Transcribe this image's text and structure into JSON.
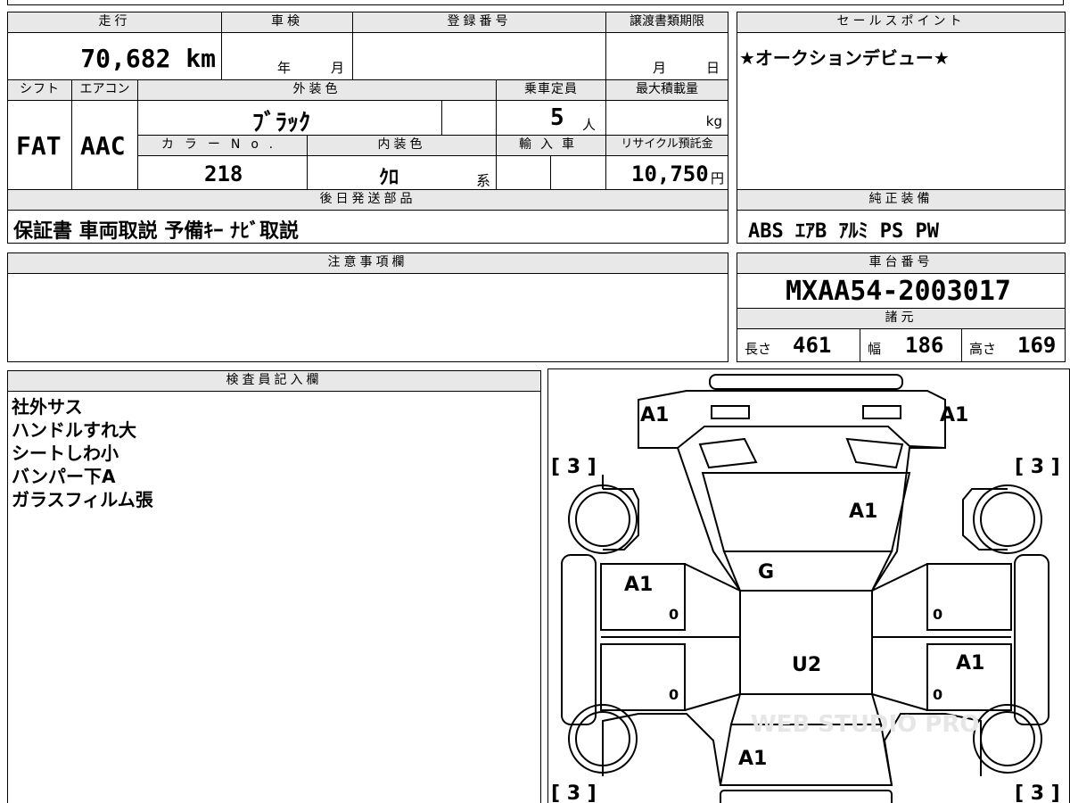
{
  "headers": {
    "mileage": "走行",
    "inspection": "車検",
    "registration": "登録番号",
    "transfer_deadline": "譲渡書類期限",
    "shift": "シフト",
    "aircon": "エアコン",
    "exterior_color": "外装色",
    "capacity": "乗車定員",
    "max_load": "最大積載量",
    "color_no": "カラーNo.",
    "interior_color": "内装色",
    "import": "輸入車",
    "recycle": "リサイクル預託金",
    "later_parts": "後日発送部品",
    "sales_point": "セールスポイント",
    "genuine_equipment": "純正装備",
    "notes": "注意事項欄",
    "chassis_no": "車台番号",
    "specs": "諸元",
    "inspector": "検査員記入欄"
  },
  "values": {
    "mileage": "70,682 km",
    "inspection_year": "年",
    "inspection_month": "月",
    "transfer_month": "月",
    "transfer_day": "日",
    "shift": "FAT",
    "aircon": "AAC",
    "exterior_color": "ﾌﾞﾗｯｸ",
    "capacity": "5",
    "capacity_unit": "人",
    "max_load_unit": "kg",
    "color_no": "218",
    "interior_color": "ｸﾛ",
    "interior_suffix": "系",
    "recycle": "10,750",
    "recycle_unit": "円",
    "later_parts": "保証書 車両取説 予備ｷｰ ﾅﾋﾞ取説",
    "sales_point": "★オークションデビュー★",
    "genuine_equipment": "ABS ｴｱB ｱﾙﾐ PS PW",
    "chassis_no": "MXAA54-2003017",
    "length_label": "長さ",
    "length": "461",
    "width_label": "幅",
    "width": "186",
    "height_label": "高さ",
    "height": "169"
  },
  "inspector_notes": [
    "社外サス",
    "ハンドルすれ大",
    "シートしわ小",
    "バンパー下A",
    "ガラスフィルム張"
  ],
  "diagram": {
    "front_left": "A1",
    "front_right": "A1",
    "hood": "A1",
    "windshield": "G",
    "left_front_door": "A1",
    "right_rear_door": "A1",
    "roof": "U2",
    "rear": "A1",
    "tire_fl": "[ 3 ]",
    "tire_fr": "[ 3 ]",
    "tire_rl": "[ 3 ]",
    "tire_rr": "[ 3 ]",
    "zero_lf": "0",
    "zero_lr": "0",
    "zero_rf": "0",
    "zero_rr": "0",
    "watermark": "WEB STUDIO PRO"
  }
}
